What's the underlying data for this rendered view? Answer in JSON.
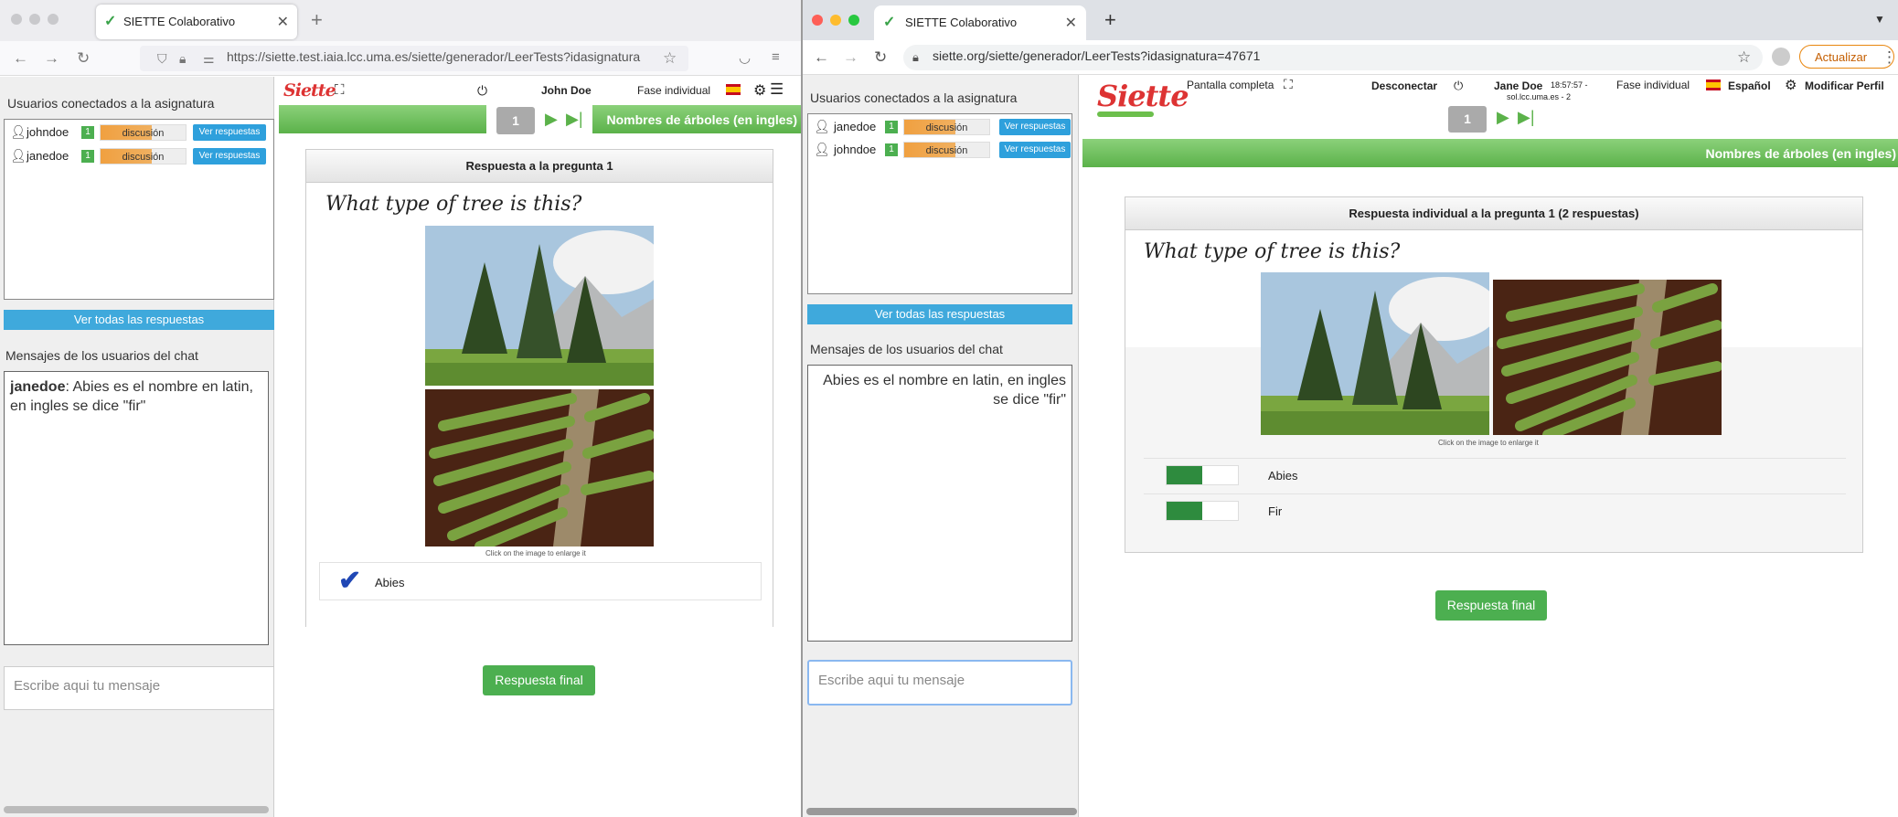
{
  "left_window": {
    "tab_title": "SIETTE Colaborativo",
    "url": "https://siette.test.iaia.lcc.uma.es/siette/generador/LeerTests?idasignatura",
    "side": {
      "users_title": "Usuarios conectados a la asignatura",
      "users": [
        {
          "name": "johndoe",
          "badge": "1",
          "status": "discusión",
          "button": "Ver respuestas"
        },
        {
          "name": "janedoe",
          "badge": "1",
          "status": "discusión",
          "button": "Ver respuestas"
        }
      ],
      "all_button": "Ver todas las respuestas",
      "chat_title": "Mensajes de los usuarios del chat",
      "chat_user": "janedoe",
      "chat_message": ": Abies es el nombre en latin, en ingles se dice \"fir\"",
      "input_placeholder": "Escribe aqui tu mensaje"
    },
    "main": {
      "logo": "Siette",
      "user": "John Doe",
      "phase": "Fase individual",
      "question_number": "1",
      "topic": "Nombres de árboles (en ingles)",
      "panel_title": "Respuesta a la pregunta 1",
      "question": "What type of tree is this?",
      "caption": "Click on the image to enlarge it",
      "answer": "Abies",
      "final_button": "Respuesta final"
    }
  },
  "right_window": {
    "tab_title": "SIETTE Colaborativo",
    "url": "siette.org/siette/generador/LeerTests?idasignatura=47671",
    "update_button": "Actualizar",
    "side": {
      "users_title": "Usuarios conectados a la asignatura",
      "users": [
        {
          "name": "janedoe",
          "badge": "1",
          "status": "discusión",
          "button": "Ver respuestas"
        },
        {
          "name": "johndoe",
          "badge": "1",
          "status": "discusión",
          "button": "Ver respuestas"
        }
      ],
      "all_button": "Ver todas las respuestas",
      "chat_title": "Mensajes de los usuarios del chat",
      "chat_message": "Abies es el nombre en latin, en ingles se dice \"fir\"",
      "input_placeholder": "Escribe aqui tu mensaje"
    },
    "main": {
      "logo": "Siette",
      "fullscreen": "Pantalla completa",
      "disconnect": "Desconectar",
      "user": "Jane Doe",
      "time": "18:57:57 -",
      "server": "sol.lcc.uma.es - 2",
      "phase": "Fase individual",
      "language": "Español",
      "profile": "Modificar Perfil",
      "question_number": "1",
      "topic": "Nombres de árboles (en ingles)",
      "panel_title": "Respuesta individual a la pregunta 1 (2 respuestas)",
      "question": "What type of tree is this?",
      "caption": "Click on the image to enlarge it",
      "answers": [
        {
          "label": "Abies",
          "fraction": 0.5
        },
        {
          "label": "Fir",
          "fraction": 0.5
        }
      ],
      "final_button": "Respuesta final"
    }
  },
  "colors": {
    "siette_red": "#d33333",
    "green": "#5bb24a",
    "blue": "#3fa9dc",
    "orange": "#f0a040"
  }
}
